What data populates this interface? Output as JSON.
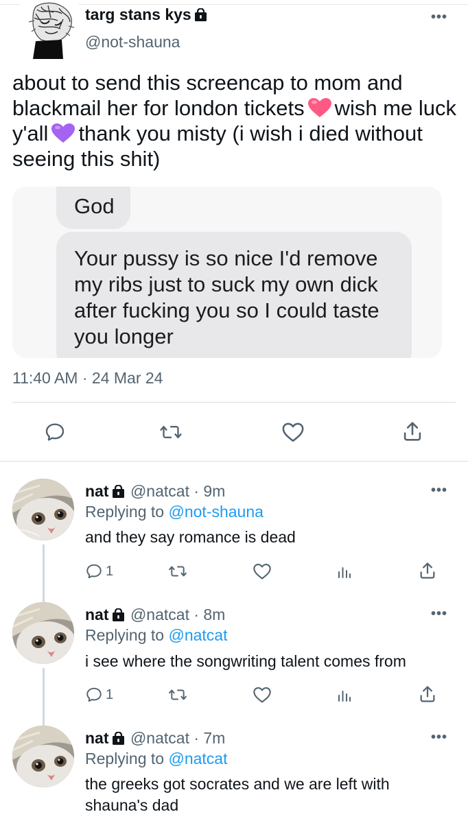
{
  "tweet": {
    "display_name": "targ stans kys",
    "handle": "@not-shauna",
    "text_part1": "about to send this screencap to mom and blackmail her for london tickets",
    "text_part2": "wish me luck y'all",
    "text_part3": "thank you misty (i wish i died without seeing this shit)",
    "emoji_1": "pink-heart",
    "emoji_2": "purple-heart",
    "screencap": {
      "message_1": "God",
      "message_2": "Your pussy is so nice I'd remove my ribs just to suck my own dick after fucking you so I could taste you longer"
    },
    "timestamp": "11:40 AM · 24 Mar 24",
    "more_label": "•••"
  },
  "replies": [
    {
      "name": "nat",
      "handle_time": "@natcat · 9m",
      "replying_label": "Replying to",
      "replying_to": "@not-shauna",
      "text": "and they say romance is dead",
      "reply_count": "1",
      "more_label": "•••"
    },
    {
      "name": "nat",
      "handle_time": "@natcat · 8m",
      "replying_label": "Replying to",
      "replying_to": "@natcat",
      "text": "i see where the songwriting talent comes from",
      "reply_count": "1",
      "more_label": "•••"
    },
    {
      "name": "nat",
      "handle_time": "@natcat · 7m",
      "replying_label": "Replying to",
      "replying_to": "@natcat",
      "text": "the greeks got socrates and we are left with shauna's dad",
      "more_label": "•••"
    }
  ],
  "colors": {
    "link_blue": "#1d9bf0",
    "secondary_gray": "#536471",
    "divider": "#d9dee2",
    "pink_heart": "#ff5a86",
    "purple_heart": "#a463f2"
  }
}
